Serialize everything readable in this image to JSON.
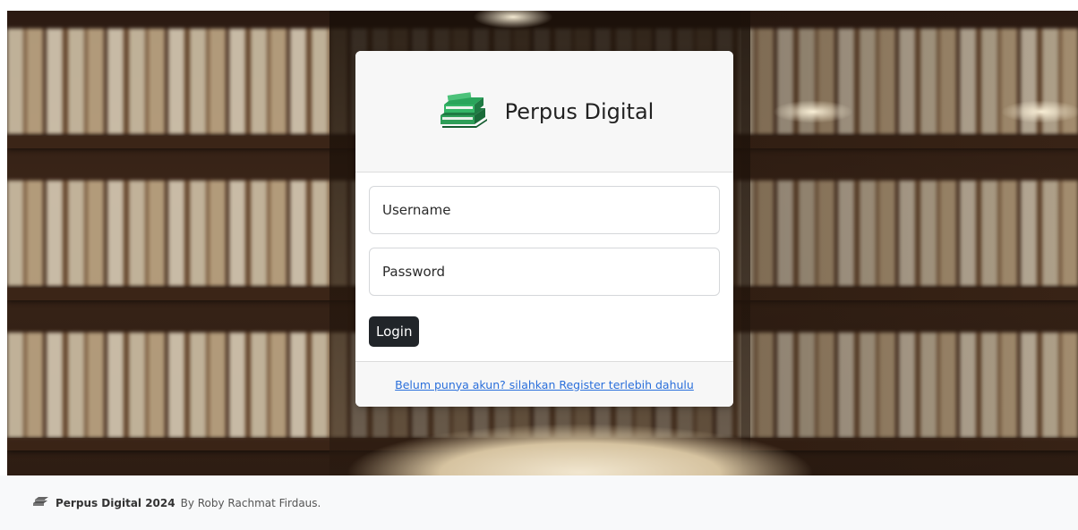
{
  "brand": {
    "title": "Perpus Digital",
    "logo_icon": "books-stack-icon",
    "accent_color": "#2e9e58"
  },
  "login_form": {
    "username_placeholder": "Username",
    "password_placeholder": "Password",
    "login_label": "Login",
    "register_link": "Belum punya akun? silahkan Register terlebih dahulu"
  },
  "footer": {
    "brand_year": "Perpus Digital 2024",
    "credit": "By Roby Rachmat Firdaus.",
    "logo_icon": "books-stack-icon"
  }
}
